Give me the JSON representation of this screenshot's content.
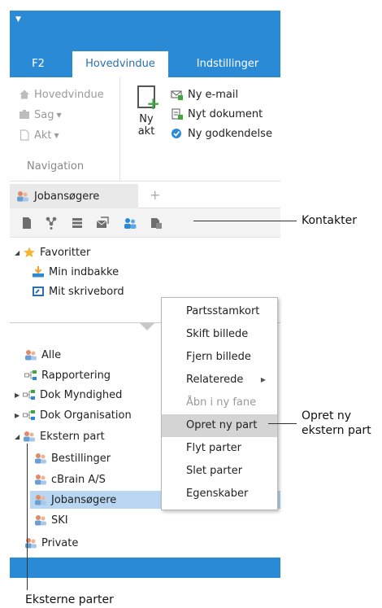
{
  "tabs": {
    "f2": "F2",
    "hovedvindue": "Hovedvindue",
    "indstillinger": "Indstillinger"
  },
  "ribbon": {
    "nav_items": [
      "Hovedvindue",
      "Sag",
      "Akt"
    ],
    "nav_group_label": "Navigation",
    "ny_akt_line1": "Ny",
    "ny_akt_line2": "akt",
    "create_items": [
      "Ny e-mail",
      "Nyt dokument",
      "Ny godkendelse"
    ]
  },
  "page_tab": {
    "label": "Jobansøgere",
    "add": "+"
  },
  "favorites": {
    "header": "Favoritter",
    "items": [
      "Min indbakke",
      "Mit skrivebord"
    ]
  },
  "tree": {
    "items": [
      "Alle",
      "Rapportering",
      "Dok Myndighed",
      "Dok Organisation",
      "Ekstern part"
    ],
    "children": [
      "Bestillinger",
      "cBrain A/S",
      "Jobansøgere",
      "SKI"
    ],
    "last": "Private"
  },
  "context_menu": {
    "items": [
      "Partsstamkort",
      "Skift billede",
      "Fjern billede",
      "Relaterede",
      "Åbn i ny fane",
      "Opret ny part",
      "Flyt parter",
      "Slet parter",
      "Egenskaber"
    ]
  },
  "callouts": {
    "kontakter": "Kontakter",
    "opret_line1": "Opret ny",
    "opret_line2": "ekstern part",
    "eksterne": "Eksterne parter"
  },
  "colors": {
    "accent": "#2b8ad6",
    "selection": "#b9d7f2",
    "highlight": "#d4d4d4"
  }
}
